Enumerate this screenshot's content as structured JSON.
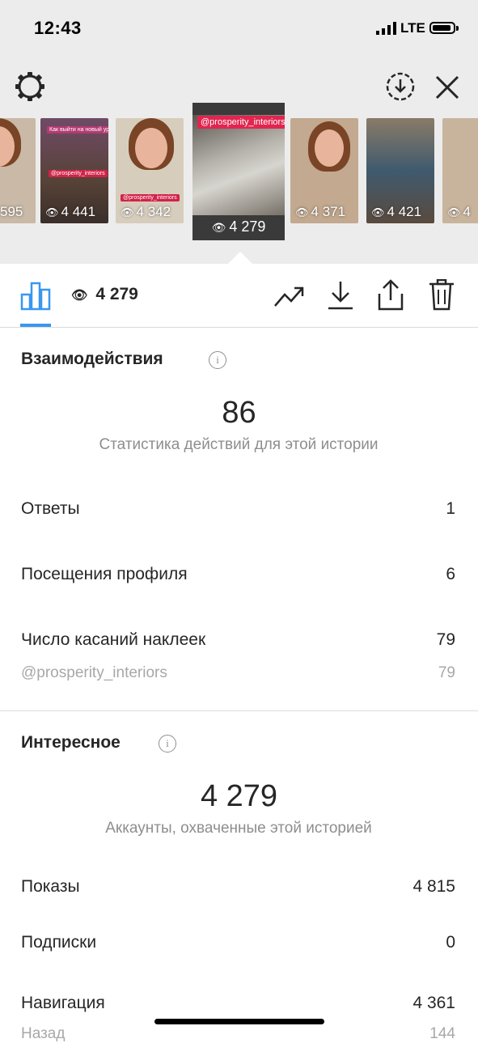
{
  "status_bar": {
    "time": "12:43",
    "network": "LTE"
  },
  "top_bar": {
    "icons": [
      "settings-icon",
      "download-circle-icon",
      "close-icon"
    ]
  },
  "thumbnails": [
    {
      "views": "595",
      "tag": ""
    },
    {
      "views": "4 441",
      "tag": "@prosperity_interiors"
    },
    {
      "views": "4 342",
      "tag": "@prosperity_interiors"
    },
    {
      "views": "4 371",
      "tag": ""
    },
    {
      "views": "4 421",
      "tag": ""
    },
    {
      "views": "4",
      "tag": ""
    }
  ],
  "selected_story": {
    "tag": "@prosperity_interiors",
    "views": "4 279"
  },
  "action_bar": {
    "views": "4 279",
    "icons": [
      "insights-tab-icon",
      "eye-icon",
      "trending-icon",
      "download-icon",
      "share-icon",
      "trash-icon"
    ]
  },
  "interactions": {
    "title": "Взаимодействия",
    "total": "86",
    "caption": "Статистика действий для этой истории",
    "rows": [
      {
        "label": "Ответы",
        "value": "1"
      },
      {
        "label": "Посещения профиля",
        "value": "6"
      },
      {
        "label": "Число касаний наклеек",
        "value": "79"
      }
    ],
    "sub_row": {
      "label": "@prosperity_interiors",
      "value": "79"
    }
  },
  "discovery": {
    "title": "Интересное",
    "total": "4 279",
    "caption": "Аккаунты, охваченные этой историей",
    "rows": [
      {
        "label": "Показы",
        "value": "4 815"
      },
      {
        "label": "Подписки",
        "value": "0"
      },
      {
        "label": "Навигация",
        "value": "4 361"
      }
    ],
    "partial_row": {
      "label": "Назад",
      "value": "144"
    }
  },
  "colors": {
    "accent": "#3897f0",
    "tag_red": "#d12349",
    "text": "#262626",
    "muted": "#8e8e8e",
    "top_bg": "#ececec"
  }
}
